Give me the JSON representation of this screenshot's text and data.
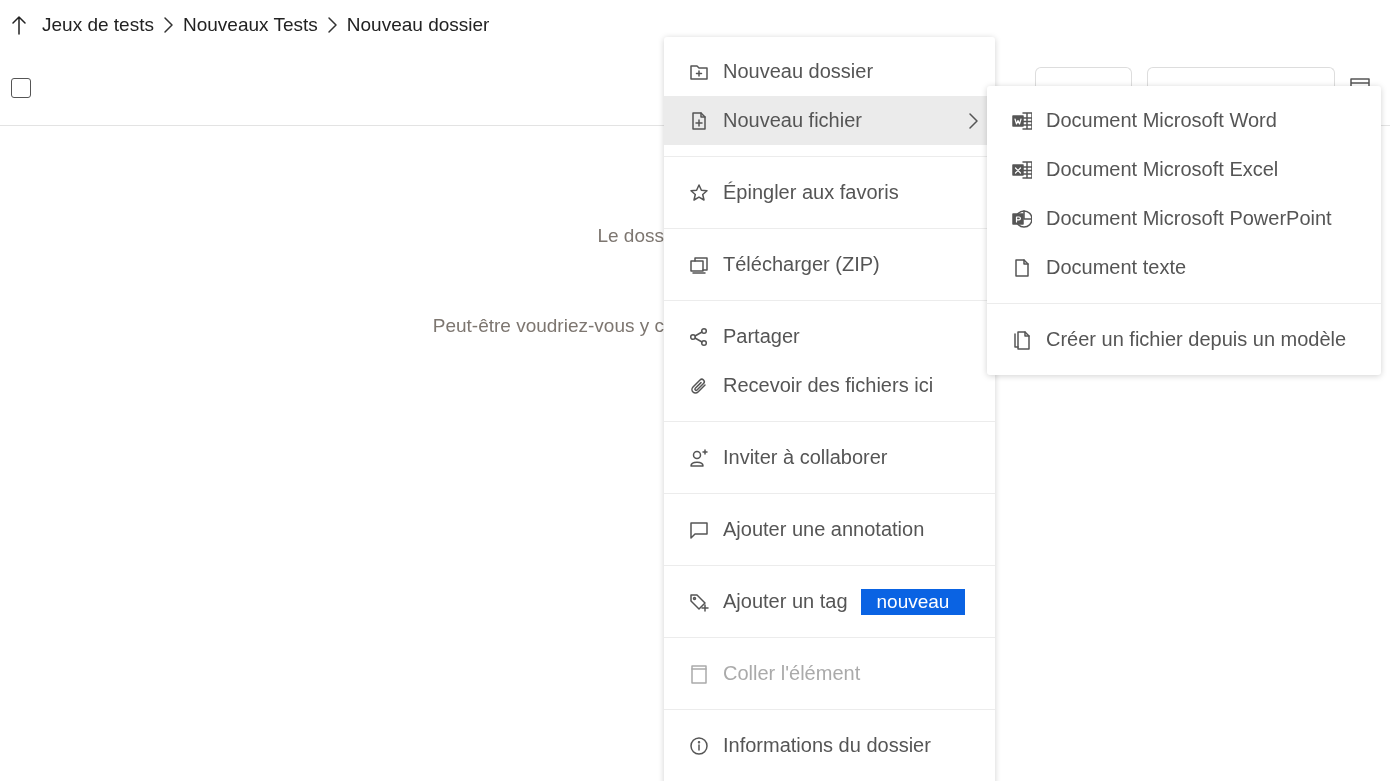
{
  "breadcrumb": {
    "items": [
      "Jeux de tests",
      "Nouveaux Tests",
      "Nouveau dossier"
    ]
  },
  "toolbar": {
    "select_all": {
      "checked": false
    }
  },
  "empty_state": {
    "title": "Le doss",
    "hint": "Peut-être voudriez-vous y c"
  },
  "context_menu": {
    "sections": [
      {
        "items": [
          {
            "label": "Nouveau dossier",
            "selected": false,
            "disabled": false,
            "has_submenu": false
          },
          {
            "label": "Nouveau fichier",
            "selected": true,
            "disabled": false,
            "has_submenu": true
          }
        ]
      },
      {
        "items": [
          {
            "label": "Épingler aux favoris",
            "selected": false,
            "disabled": false,
            "has_submenu": false
          }
        ]
      },
      {
        "items": [
          {
            "label": "Télécharger (ZIP)",
            "selected": false,
            "disabled": false,
            "has_submenu": false
          }
        ]
      },
      {
        "items": [
          {
            "label": "Partager",
            "selected": false,
            "disabled": false,
            "has_submenu": false
          },
          {
            "label": "Recevoir des fichiers ici",
            "selected": false,
            "disabled": false,
            "has_submenu": false
          }
        ]
      },
      {
        "items": [
          {
            "label": "Inviter à collaborer",
            "selected": false,
            "disabled": false,
            "has_submenu": false
          }
        ]
      },
      {
        "items": [
          {
            "label": "Ajouter une annotation",
            "selected": false,
            "disabled": false,
            "has_submenu": false
          }
        ]
      },
      {
        "items": [
          {
            "label": "Ajouter un tag",
            "badge": "nouveau",
            "selected": false,
            "disabled": false,
            "has_submenu": false
          }
        ]
      },
      {
        "items": [
          {
            "label": "Coller l'élément",
            "selected": false,
            "disabled": true,
            "has_submenu": false
          }
        ]
      },
      {
        "items": [
          {
            "label": "Informations du dossier",
            "selected": false,
            "disabled": false,
            "has_submenu": false
          }
        ]
      }
    ]
  },
  "submenu": {
    "sections": [
      {
        "items": [
          {
            "label": "Document Microsoft Word",
            "selected": false
          },
          {
            "label": "Document Microsoft Excel",
            "selected": false
          },
          {
            "label": "Document Microsoft PowerPoint",
            "selected": false
          },
          {
            "label": "Document texte",
            "selected": false
          }
        ]
      },
      {
        "items": [
          {
            "label": "Créer un fichier depuis un modèle",
            "selected": false
          }
        ]
      }
    ]
  }
}
